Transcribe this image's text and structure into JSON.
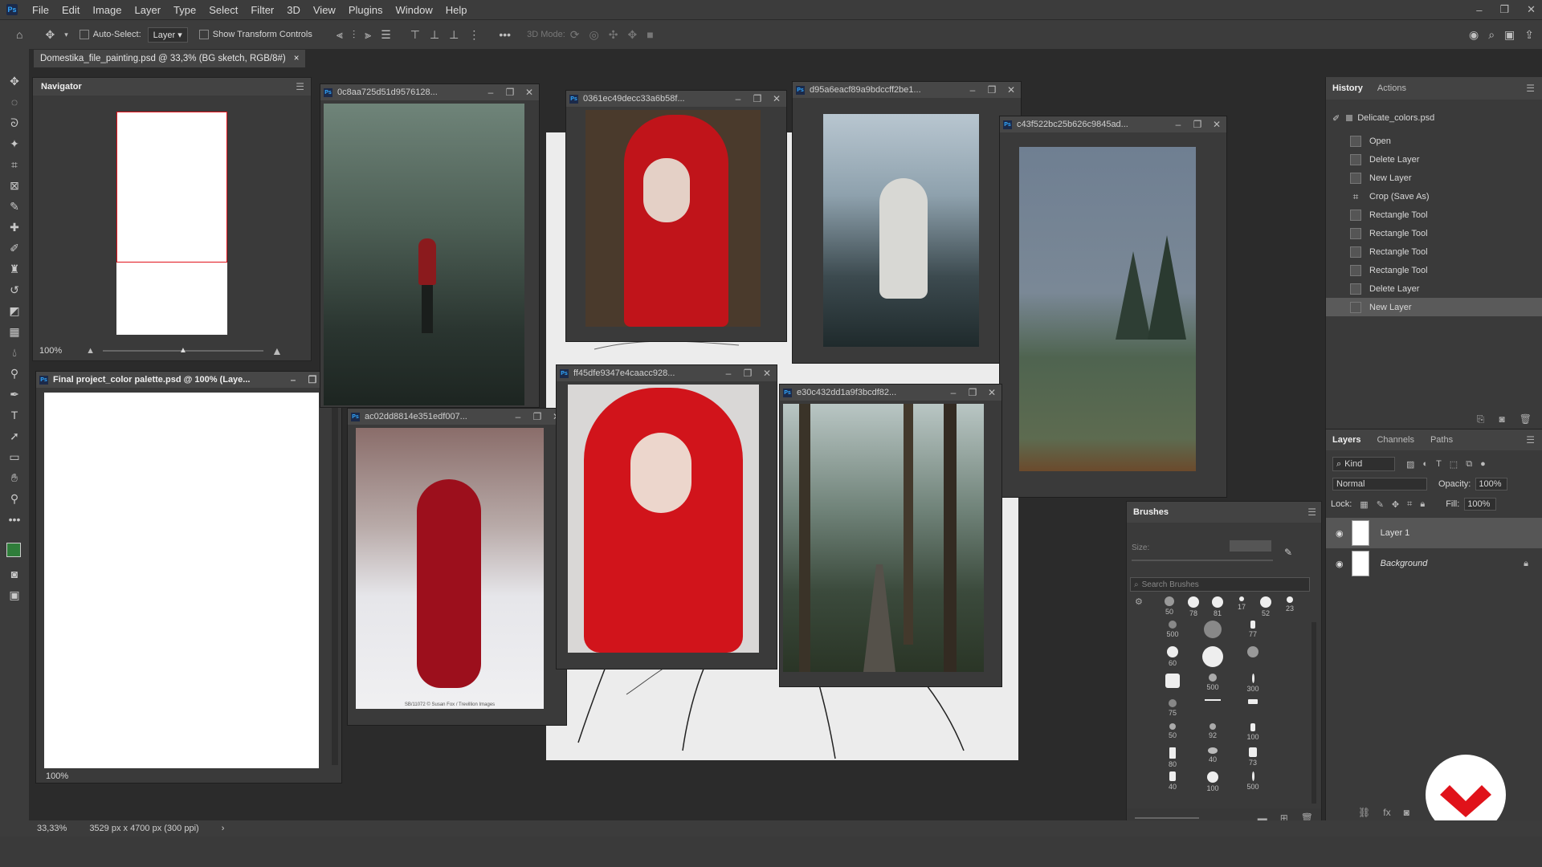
{
  "menubar": {
    "logo": "Ps",
    "items": [
      "File",
      "Edit",
      "Image",
      "Layer",
      "Type",
      "Select",
      "Filter",
      "3D",
      "View",
      "Plugins",
      "Window",
      "Help"
    ]
  },
  "options": {
    "auto_select_label": "Auto-Select:",
    "auto_select_value": "Layer",
    "show_transform_label": "Show Transform Controls",
    "mode_3d_label": "3D Mode:"
  },
  "doc_tab": {
    "title": "Domestika_file_painting.psd @ 33,3% (BG sketch, RGB/8#)",
    "close": "×"
  },
  "navigator": {
    "tab": "Navigator",
    "zoom": "100%"
  },
  "windows": [
    {
      "title": "Final project_color palette.psd @ 100% (Laye...",
      "zoom": "100%"
    },
    {
      "title": "0c8aa725d51d9576128..."
    },
    {
      "title": "0361ec49decc33a6b58f..."
    },
    {
      "title": "d95a6eacf89a9bdccff2be1..."
    },
    {
      "title": "c43f522bc25b626c9845ad..."
    },
    {
      "title": "ac02dd8814e351edf007..."
    },
    {
      "title": "ff45dfe9347e4caacc928..."
    },
    {
      "title": "e30c432dd1a9f3bcdf82..."
    }
  ],
  "photo_credit": "SB/11072 © Susan Fox / Trevillion Images",
  "history": {
    "tabs": [
      "History",
      "Actions"
    ],
    "snapshot": "Delicate_colors.psd",
    "items": [
      "Open",
      "Delete Layer",
      "New Layer",
      "Crop (Save As)",
      "Rectangle Tool",
      "Rectangle Tool",
      "Rectangle Tool",
      "Rectangle Tool",
      "Delete Layer",
      "New Layer"
    ],
    "selected_index": 9
  },
  "layers": {
    "tabs": [
      "Layers",
      "Channels",
      "Paths"
    ],
    "kind": "Kind",
    "blend": "Normal",
    "opacity_label": "Opacity:",
    "opacity": "100%",
    "lock_label": "Lock:",
    "fill_label": "Fill:",
    "fill": "100%",
    "rows": [
      {
        "name": "Layer 1"
      },
      {
        "name": "Background"
      }
    ]
  },
  "brushes": {
    "tab": "Brushes",
    "size_label": "Size:",
    "search_placeholder": "Search Brushes",
    "top_row": [
      "50",
      "78",
      "81",
      "17",
      "52",
      "23"
    ],
    "grid": [
      "500",
      "",
      "77",
      "60",
      "",
      "",
      "",
      "500",
      "300",
      "75",
      "",
      "",
      "50",
      "92",
      "100",
      "80",
      "40",
      "73",
      "40",
      "100",
      "500"
    ]
  },
  "status": {
    "zoom": "33,33%",
    "dims": "3529 px x 4700 px (300 ppi)",
    "arrow": "›"
  },
  "colors": {
    "accent_red": "#e0121a",
    "selected_row": "#5a5a5a"
  }
}
